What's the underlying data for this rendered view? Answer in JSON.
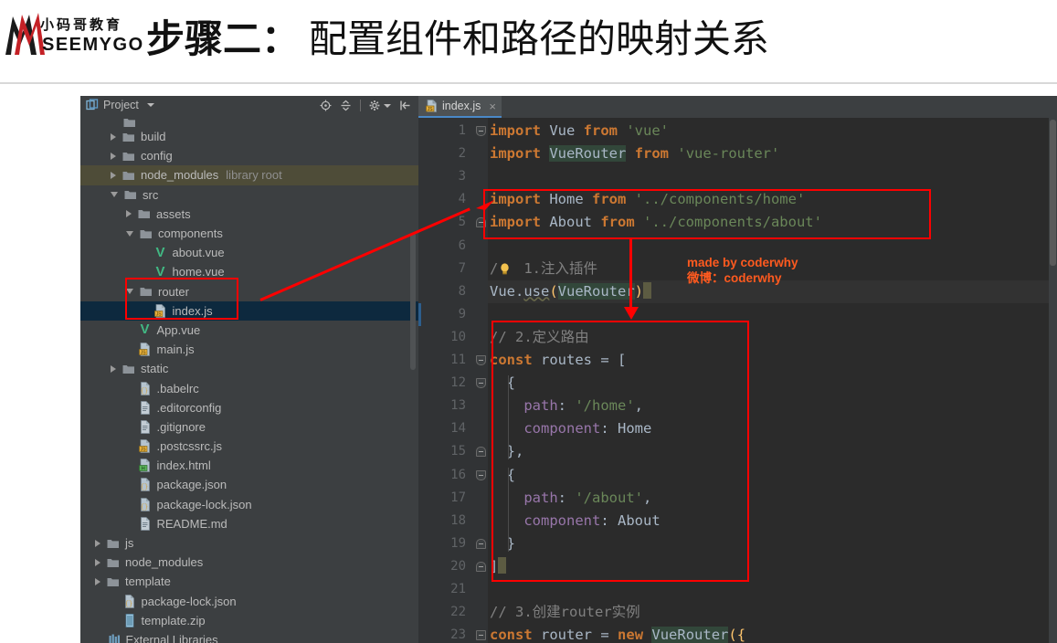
{
  "header": {
    "logo_cn": "小码哥教育",
    "logo_en": "SEEMYGO",
    "title_bold": "步骤二：",
    "title_light": "配置组件和路径的映射关系"
  },
  "project_panel": {
    "title": "Project",
    "tools": [
      {
        "name": "locate-icon",
        "title": "Select Opened File"
      },
      {
        "name": "collapse-all-icon",
        "title": "Collapse All"
      },
      {
        "name": "settings-gear-icon",
        "title": "Settings"
      },
      {
        "name": "hide-panel-icon",
        "title": "Hide"
      }
    ],
    "tree": [
      {
        "indent": 1,
        "twisty": "none",
        "icon": "folder",
        "label": "",
        "cut": true
      },
      {
        "indent": 1,
        "twisty": "right",
        "icon": "folder",
        "label": "build"
      },
      {
        "indent": 1,
        "twisty": "right",
        "icon": "folder",
        "label": "config"
      },
      {
        "indent": 1,
        "twisty": "right",
        "icon": "folder",
        "label": "node_modules",
        "sublabel": "library root",
        "style": "libroot"
      },
      {
        "indent": 1,
        "twisty": "down",
        "icon": "folder",
        "label": "src"
      },
      {
        "indent": 2,
        "twisty": "right",
        "icon": "folder",
        "label": "assets"
      },
      {
        "indent": 2,
        "twisty": "down",
        "icon": "folder",
        "label": "components"
      },
      {
        "indent": 3,
        "twisty": "none",
        "icon": "vue",
        "label": "about.vue"
      },
      {
        "indent": 3,
        "twisty": "none",
        "icon": "vue",
        "label": "home.vue"
      },
      {
        "indent": 2,
        "twisty": "down",
        "icon": "folder",
        "label": "router"
      },
      {
        "indent": 3,
        "twisty": "none",
        "icon": "js",
        "label": "index.js",
        "style": "selected"
      },
      {
        "indent": 2,
        "twisty": "none",
        "icon": "vue",
        "label": "App.vue"
      },
      {
        "indent": 2,
        "twisty": "none",
        "icon": "js",
        "label": "main.js"
      },
      {
        "indent": 1,
        "twisty": "right",
        "icon": "folder",
        "label": "static"
      },
      {
        "indent": 2,
        "twisty": "none",
        "icon": "json",
        "label": ".babelrc"
      },
      {
        "indent": 2,
        "twisty": "none",
        "icon": "text",
        "label": ".editorconfig"
      },
      {
        "indent": 2,
        "twisty": "none",
        "icon": "text",
        "label": ".gitignore"
      },
      {
        "indent": 2,
        "twisty": "none",
        "icon": "js",
        "label": ".postcssrc.js"
      },
      {
        "indent": 2,
        "twisty": "none",
        "icon": "html",
        "label": "index.html"
      },
      {
        "indent": 2,
        "twisty": "none",
        "icon": "json",
        "label": "package.json"
      },
      {
        "indent": 2,
        "twisty": "none",
        "icon": "json",
        "label": "package-lock.json"
      },
      {
        "indent": 2,
        "twisty": "none",
        "icon": "text",
        "label": "README.md"
      },
      {
        "indent": 0,
        "twisty": "right",
        "icon": "folder",
        "label": "js"
      },
      {
        "indent": 0,
        "twisty": "right",
        "icon": "folder",
        "label": "node_modules"
      },
      {
        "indent": 0,
        "twisty": "right",
        "icon": "folder",
        "label": "template"
      },
      {
        "indent": 1,
        "twisty": "none",
        "icon": "json",
        "label": "package-lock.json"
      },
      {
        "indent": 1,
        "twisty": "none",
        "icon": "zip",
        "label": "template.zip"
      },
      {
        "indent": 0,
        "twisty": "none",
        "icon": "lib",
        "label": "External Libraries"
      }
    ]
  },
  "editor": {
    "tab": {
      "label": "index.js",
      "icon": "js-file-icon",
      "close": "×"
    },
    "line_numbers": [
      1,
      2,
      3,
      4,
      5,
      6,
      7,
      8,
      9,
      10,
      11,
      12,
      13,
      14,
      15,
      16,
      17,
      18,
      19,
      20,
      21,
      22,
      23
    ],
    "lines": [
      "import Vue from 'vue'",
      "import VueRouter from 'vue-router'",
      "",
      "import Home from '../components/home'",
      "import About from '../components/about'",
      "",
      "// 1.注入插件",
      "Vue.use(VueRouter)",
      "",
      "// 2.定义路由",
      "const routes = [",
      "  {",
      "    path: '/home',",
      "    component: Home",
      "  },",
      "  {",
      "    path: '/about',",
      "    component: About",
      "  }",
      "]",
      "",
      "// 3.创建router实例",
      "const router = new VueRouter({"
    ]
  },
  "annotations": {
    "watermark_line1": "made by coderwhy",
    "watermark_line2": "微博：coderwhy"
  },
  "colors": {
    "accent_red": "#ff0000",
    "watermark": "#ff5a1f",
    "editor_bg": "#2b2b2b",
    "panel_bg": "#3c3f41",
    "selection": "#0d293e",
    "library_root": "#4e4c38",
    "tab_underline": "#4a88c7",
    "vue_green": "#41b883"
  }
}
